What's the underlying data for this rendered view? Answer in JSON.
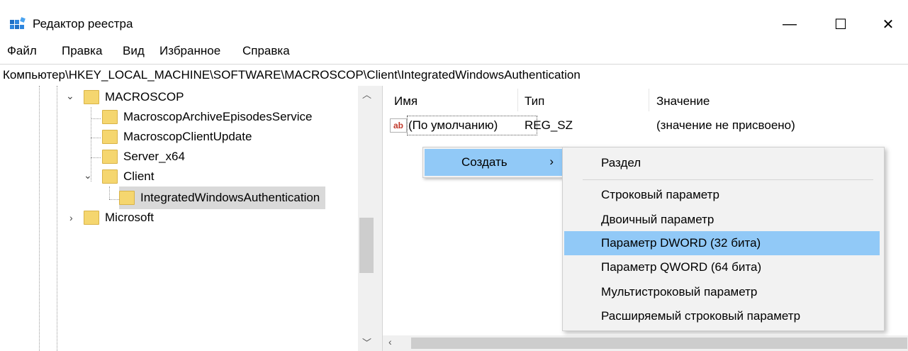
{
  "window": {
    "title": "Редактор реестра",
    "minimize": "—",
    "maximize": "☐",
    "close": "✕"
  },
  "menu": [
    "Файл",
    "Правка",
    "Вид",
    "Избранное",
    "Справка"
  ],
  "address": "Компьютер\\HKEY_LOCAL_MACHINE\\SOFTWARE\\MACROSCOP\\Client\\IntegratedWindowsAuthentication",
  "tree": {
    "macroscop": "MACROSCOP",
    "archive": "MacroscopArchiveEpisodesService",
    "update": "MacroscopClientUpdate",
    "server": "Server_x64",
    "client": "Client",
    "iwa": "IntegratedWindowsAuthentication",
    "microsoft": "Microsoft"
  },
  "columns": {
    "name": "Имя",
    "type": "Тип",
    "value": "Значение"
  },
  "rows": [
    {
      "icon": "ab",
      "name": "(По умолчанию)",
      "type": "REG_SZ",
      "value": "(значение не присвоено)"
    }
  ],
  "context_menu": {
    "create": "Создать",
    "arrow": "›"
  },
  "submenu": [
    "Раздел",
    "Строковый параметр",
    "Двоичный параметр",
    "Параметр DWORD (32 бита)",
    "Параметр QWORD (64 бита)",
    "Мультистроковый параметр",
    "Расширяемый строковый параметр"
  ],
  "submenu_highlighted": "Параметр DWORD (32 бита)",
  "colors": {
    "highlight": "#91c9f7",
    "folder": "#f5d66f"
  }
}
